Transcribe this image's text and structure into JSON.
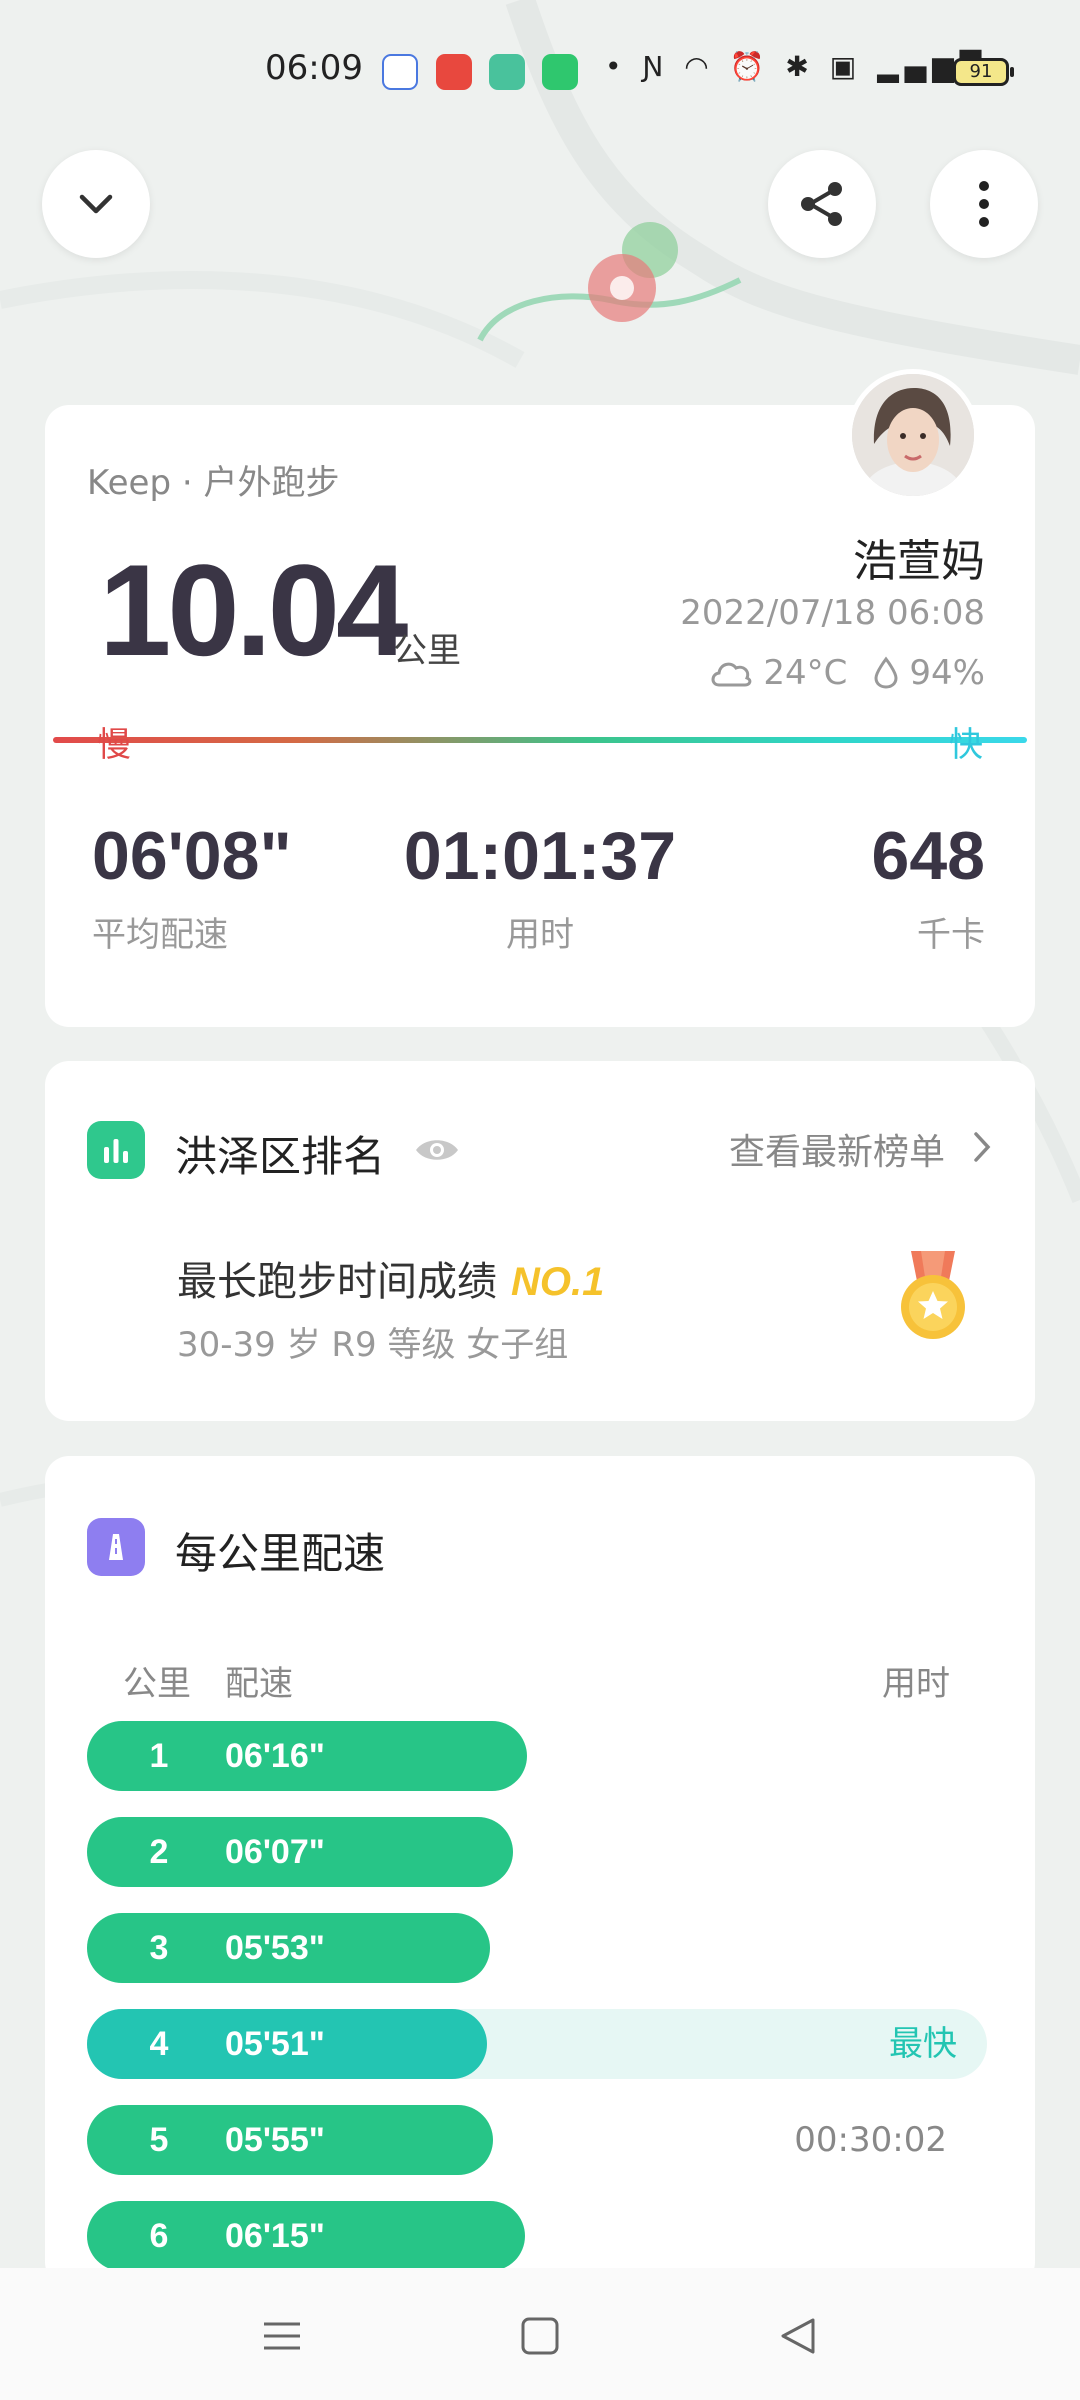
{
  "status_bar": {
    "time": "06:09",
    "battery": "91",
    "icons": [
      "dot-icon",
      "nfc-icon",
      "headset-icon",
      "alarm-icon",
      "bluetooth-icon",
      "hd-icon",
      "signal-4g-icon",
      "battery-icon"
    ]
  },
  "summary": {
    "source": "Keep · 户外跑步",
    "distance": "10.04",
    "distance_unit": "公里",
    "user_name": "浩萱妈",
    "datetime": "2022/07/18 06:08",
    "temperature": "24°C",
    "humidity": "94%",
    "slow_label": "慢",
    "fast_label": "快",
    "stats": [
      {
        "value": "06'08\"",
        "label": "平均配速"
      },
      {
        "value": "01:01:37",
        "label": "用时"
      },
      {
        "value": "648",
        "label": "千卡"
      }
    ]
  },
  "ranking": {
    "title": "洪泽区排名",
    "link": "查看最新榜单",
    "achievement": "最长跑步时间成绩",
    "rank": "NO.1",
    "group": "30-39 岁 R9 等级 女子组"
  },
  "splits": {
    "title": "每公里配速",
    "col_km": "公里",
    "col_pace": "配速",
    "col_time": "用时",
    "rows": [
      {
        "km": "1",
        "pace": "06'16\"",
        "pace_seconds": 376,
        "right": ""
      },
      {
        "km": "2",
        "pace": "06'07\"",
        "pace_seconds": 367,
        "right": ""
      },
      {
        "km": "3",
        "pace": "05'53\"",
        "pace_seconds": 353,
        "right": ""
      },
      {
        "km": "4",
        "pace": "05'51\"",
        "pace_seconds": 351,
        "right": "最快",
        "best": true
      },
      {
        "km": "5",
        "pace": "05'55\"",
        "pace_seconds": 355,
        "right": "00:30:02"
      },
      {
        "km": "6",
        "pace": "06'15\"",
        "pace_seconds": 375,
        "right": ""
      }
    ]
  },
  "colors": {
    "accent": "#27c587",
    "best": "#23c5b2",
    "gold": "#f5c22b"
  }
}
